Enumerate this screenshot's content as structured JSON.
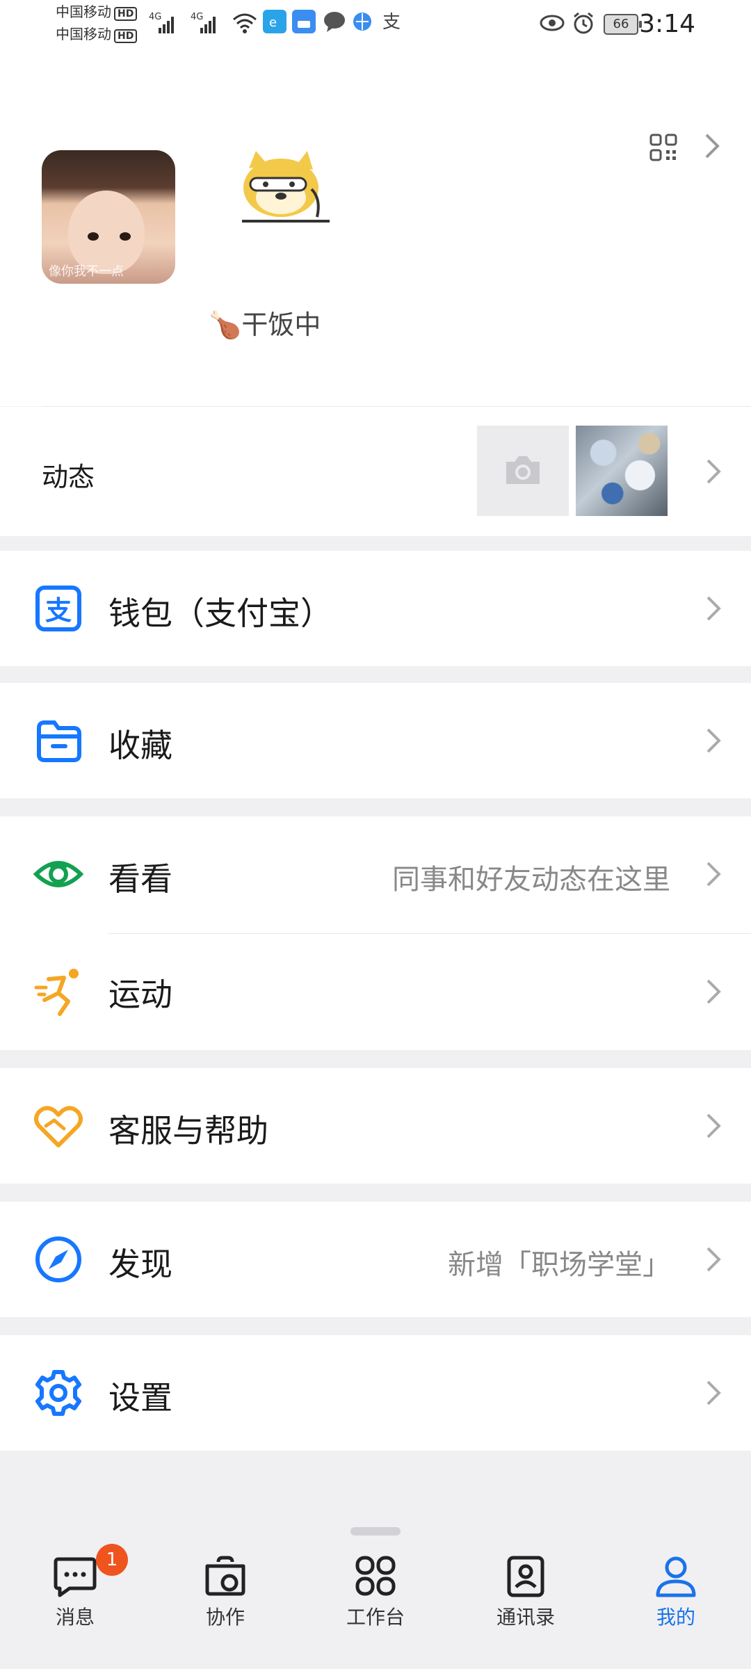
{
  "status_bar": {
    "carrier1": "中国移动",
    "carrier2": "中国移动",
    "hd": "HD",
    "network": "4G",
    "battery": "66",
    "time": "3:14"
  },
  "profile": {
    "avatar_caption": "像你我不一点",
    "status": "🍗干饭中"
  },
  "moments": {
    "label": "动态"
  },
  "menu": {
    "wallet": {
      "label": "钱包（支付宝）"
    },
    "favorites": {
      "label": "收藏"
    },
    "watch": {
      "label": "看看",
      "hint": "同事和好友动态在这里"
    },
    "sport": {
      "label": "运动"
    },
    "support": {
      "label": "客服与帮助"
    },
    "discover": {
      "label": "发现",
      "hint": "新增「职场学堂」"
    },
    "settings": {
      "label": "设置"
    }
  },
  "nav": {
    "messages": {
      "label": "消息",
      "badge": "1"
    },
    "collab": {
      "label": "协作"
    },
    "workbench": {
      "label": "工作台"
    },
    "contacts": {
      "label": "通讯录"
    },
    "me": {
      "label": "我的"
    }
  },
  "colors": {
    "accent": "#1a73e8",
    "wallet_icon": "#1677ff",
    "watch_icon": "#12a150",
    "sport_icon": "#f5a623",
    "support_icon": "#f5a623",
    "badge": "#f0541e"
  },
  "icons": {
    "wallet": "alipay-icon",
    "favorites": "folder-icon",
    "watch": "eye-icon",
    "sport": "running-icon",
    "support": "heart-hand-icon",
    "discover": "compass-icon",
    "settings": "gear-icon"
  }
}
